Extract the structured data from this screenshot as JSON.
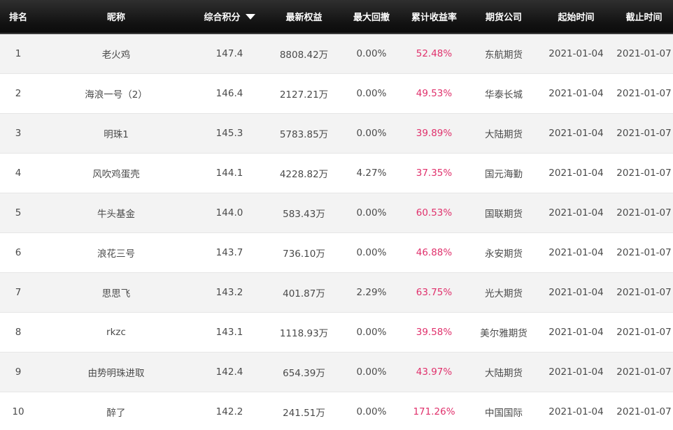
{
  "columns": {
    "rank": "排名",
    "nickname": "昵称",
    "score": "综合积分",
    "equity": "最新权益",
    "drawdown": "最大回撤",
    "return": "累计收益率",
    "company": "期货公司",
    "start": "起始时间",
    "end": "截止时间"
  },
  "sort": {
    "column": "score",
    "direction": "desc",
    "icon": "sort-down-triangle-icon"
  },
  "colors": {
    "header_bg": "#141414",
    "return_text": "#e0316c",
    "row_alt": "#f3f3f3"
  },
  "rows": [
    {
      "rank": "1",
      "nickname": "老火鸡",
      "score": "147.4",
      "equity": "8808.42万",
      "drawdown": "0.00%",
      "return": "52.48%",
      "company": "东航期货",
      "start": "2021-01-04",
      "end": "2021-01-07"
    },
    {
      "rank": "2",
      "nickname": "海浪一号（2）",
      "score": "146.4",
      "equity": "2127.21万",
      "drawdown": "0.00%",
      "return": "49.53%",
      "company": "华泰长城",
      "start": "2021-01-04",
      "end": "2021-01-07"
    },
    {
      "rank": "3",
      "nickname": "明珠1",
      "score": "145.3",
      "equity": "5783.85万",
      "drawdown": "0.00%",
      "return": "39.89%",
      "company": "大陆期货",
      "start": "2021-01-04",
      "end": "2021-01-07"
    },
    {
      "rank": "4",
      "nickname": "风吹鸡蛋壳",
      "score": "144.1",
      "equity": "4228.82万",
      "drawdown": "4.27%",
      "return": "37.35%",
      "company": "国元海勤",
      "start": "2021-01-04",
      "end": "2021-01-07"
    },
    {
      "rank": "5",
      "nickname": "牛头基金",
      "score": "144.0",
      "equity": "583.43万",
      "drawdown": "0.00%",
      "return": "60.53%",
      "company": "国联期货",
      "start": "2021-01-04",
      "end": "2021-01-07"
    },
    {
      "rank": "6",
      "nickname": "浪花三号",
      "score": "143.7",
      "equity": "736.10万",
      "drawdown": "0.00%",
      "return": "46.88%",
      "company": "永安期货",
      "start": "2021-01-04",
      "end": "2021-01-07"
    },
    {
      "rank": "7",
      "nickname": "思思飞",
      "score": "143.2",
      "equity": "401.87万",
      "drawdown": "2.29%",
      "return": "63.75%",
      "company": "光大期货",
      "start": "2021-01-04",
      "end": "2021-01-07"
    },
    {
      "rank": "8",
      "nickname": "rkzc",
      "score": "143.1",
      "equity": "1118.93万",
      "drawdown": "0.00%",
      "return": "39.58%",
      "company": "美尔雅期货",
      "start": "2021-01-04",
      "end": "2021-01-07"
    },
    {
      "rank": "9",
      "nickname": "由势明珠进取",
      "score": "142.4",
      "equity": "654.39万",
      "drawdown": "0.00%",
      "return": "43.97%",
      "company": "大陆期货",
      "start": "2021-01-04",
      "end": "2021-01-07"
    },
    {
      "rank": "10",
      "nickname": "醉了",
      "score": "142.2",
      "equity": "241.51万",
      "drawdown": "0.00%",
      "return": "171.26%",
      "company": "中国国际",
      "start": "2021-01-04",
      "end": "2021-01-07"
    }
  ]
}
